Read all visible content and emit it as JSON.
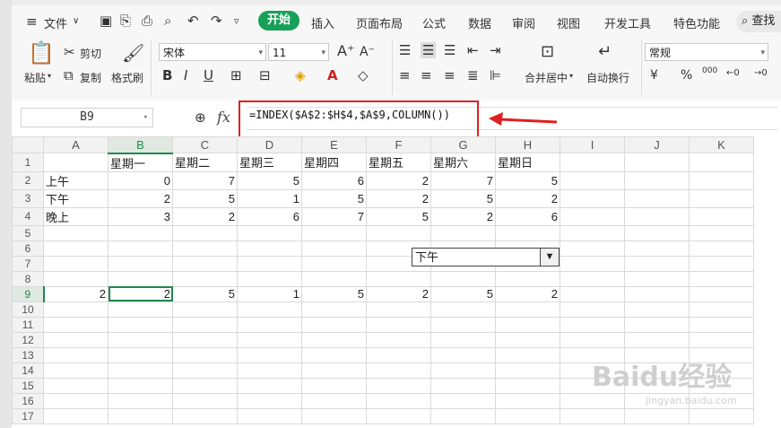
{
  "menu": {
    "file": "文件",
    "tabs": [
      "开始",
      "插入",
      "页面布局",
      "公式",
      "数据",
      "审阅",
      "视图",
      "开发工具",
      "特色功能"
    ],
    "search": "查找"
  },
  "ribbon": {
    "paste": "粘贴",
    "cut": "剪切",
    "copy": "复制",
    "format_painter": "格式刷",
    "font_name": "宋体",
    "font_size": "11",
    "merge_center": "合并居中",
    "wrap_text": "自动换行",
    "number_format": "常规",
    "currency": "¥",
    "percent": "%",
    "thousands": "000"
  },
  "formula_bar": {
    "cell_ref": "B9",
    "fx": "fx",
    "formula": "=INDEX($A$2:$H$4,$A$9,COLUMN())"
  },
  "sheet": {
    "columns": [
      "A",
      "B",
      "C",
      "D",
      "E",
      "F",
      "G",
      "H",
      "I",
      "J",
      "K"
    ],
    "rows": [
      [
        "",
        "星期一",
        "星期二",
        "星期三",
        "星期四",
        "星期五",
        "星期六",
        "星期日",
        "",
        "",
        ""
      ],
      [
        "上午",
        "0",
        "7",
        "5",
        "6",
        "2",
        "7",
        "5",
        "",
        "",
        ""
      ],
      [
        "下午",
        "2",
        "5",
        "1",
        "5",
        "2",
        "5",
        "2",
        "",
        "",
        ""
      ],
      [
        "晚上",
        "3",
        "2",
        "6",
        "7",
        "5",
        "2",
        "6",
        "",
        "",
        ""
      ],
      [
        "",
        "",
        "",
        "",
        "",
        "",
        "",
        "",
        "",
        "",
        ""
      ],
      [
        "",
        "",
        "",
        "",
        "",
        "",
        "",
        "",
        "",
        "",
        ""
      ],
      [
        "",
        "",
        "",
        "",
        "",
        "",
        "",
        "",
        "",
        "",
        ""
      ],
      [
        "",
        "",
        "",
        "",
        "",
        "",
        "",
        "",
        "",
        "",
        ""
      ],
      [
        "2",
        "2",
        "5",
        "1",
        "5",
        "2",
        "5",
        "2",
        "",
        "",
        ""
      ],
      [
        "",
        "",
        "",
        "",
        "",
        "",
        "",
        "",
        "",
        "",
        ""
      ],
      [
        "",
        "",
        "",
        "",
        "",
        "",
        "",
        "",
        "",
        "",
        ""
      ],
      [
        "",
        "",
        "",
        "",
        "",
        "",
        "",
        "",
        "",
        "",
        ""
      ],
      [
        "",
        "",
        "",
        "",
        "",
        "",
        "",
        "",
        "",
        "",
        ""
      ],
      [
        "",
        "",
        "",
        "",
        "",
        "",
        "",
        "",
        "",
        "",
        ""
      ],
      [
        "",
        "",
        "",
        "",
        "",
        "",
        "",
        "",
        "",
        "",
        ""
      ],
      [
        "",
        "",
        "",
        "",
        "",
        "",
        "",
        "",
        "",
        "",
        ""
      ],
      [
        "",
        "",
        "",
        "",
        "",
        "",
        "",
        "",
        "",
        "",
        ""
      ]
    ],
    "active_cell": "B9",
    "dropdown_value": "下午"
  },
  "watermark": {
    "logo": "Baidu经验",
    "url": "jingyan.baidu.com"
  },
  "colors": {
    "accent": "#18a058",
    "annotation": "#e02020"
  }
}
